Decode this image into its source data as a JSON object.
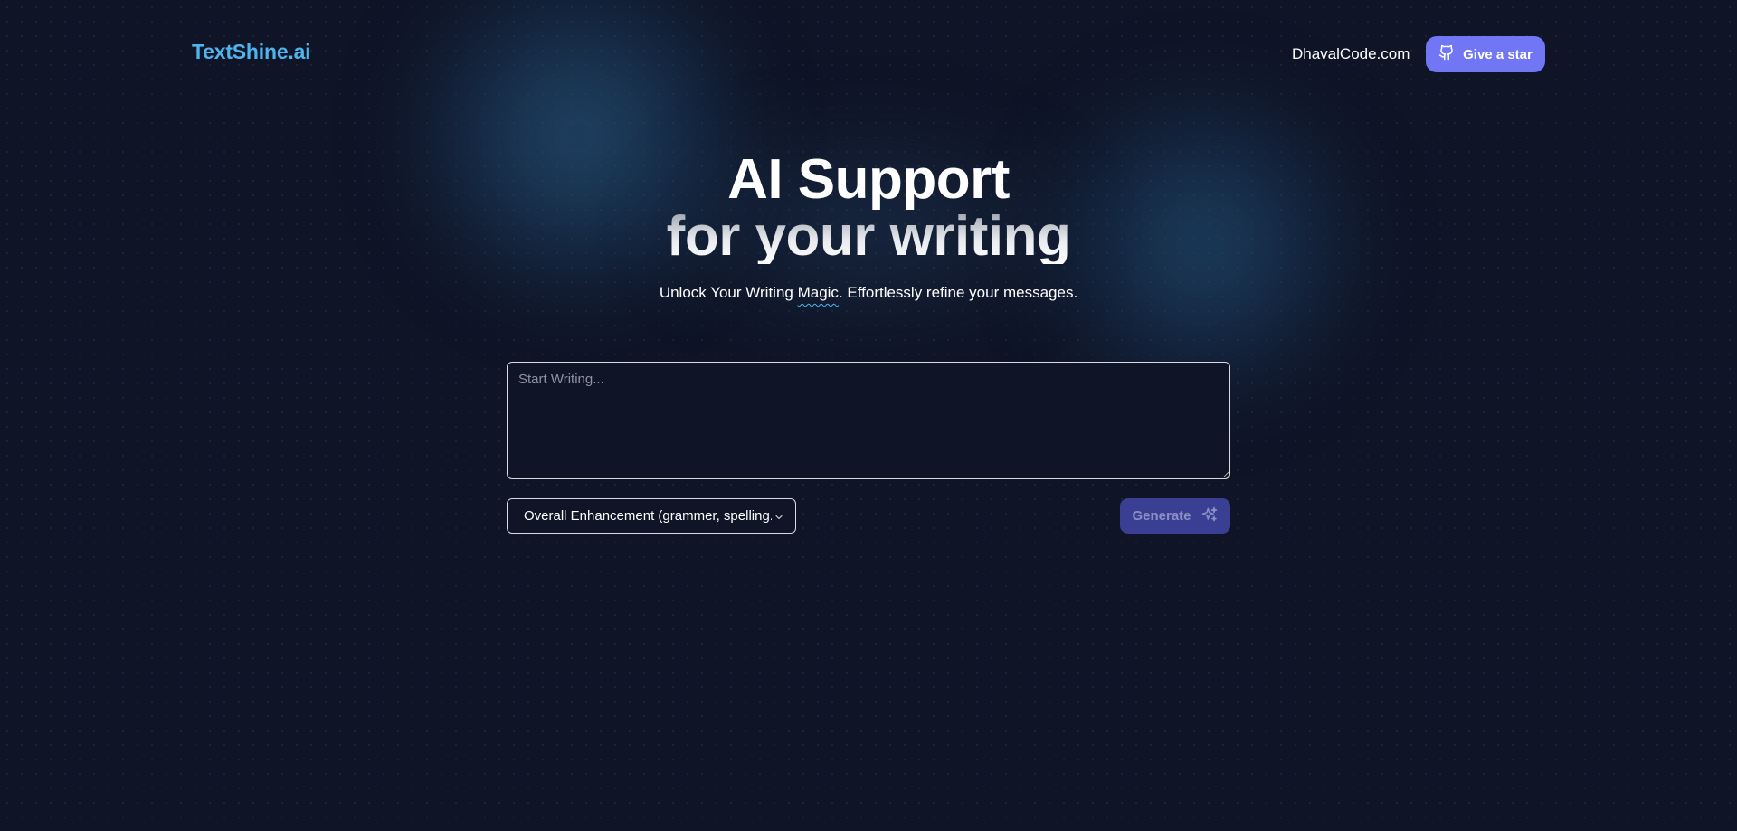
{
  "header": {
    "logo": "TextShine.ai",
    "site_link": "DhavalCode.com",
    "star_button": "Give a star"
  },
  "hero": {
    "line1": "AI Support",
    "line2": "for your writing",
    "subtitle_pre": "Unlock Your Writing ",
    "subtitle_emph": "Magic",
    "subtitle_post": ". Effortlessly refine your messages."
  },
  "editor": {
    "value": "",
    "placeholder": "Start Writing..."
  },
  "controls": {
    "mode_selected": "Overall Enhancement (grammer, spelling..",
    "generate_label": "Generate",
    "generate_enabled": false
  },
  "colors": {
    "background": "#0f1426",
    "logo": "#4fb4ee",
    "accent": "#7076f4",
    "generate_disabled": "#3b3f93"
  },
  "icons": {
    "star_button_icon": "github-icon",
    "generate_icon": "sparkles-icon",
    "select_icon": "chevron-down-icon"
  }
}
